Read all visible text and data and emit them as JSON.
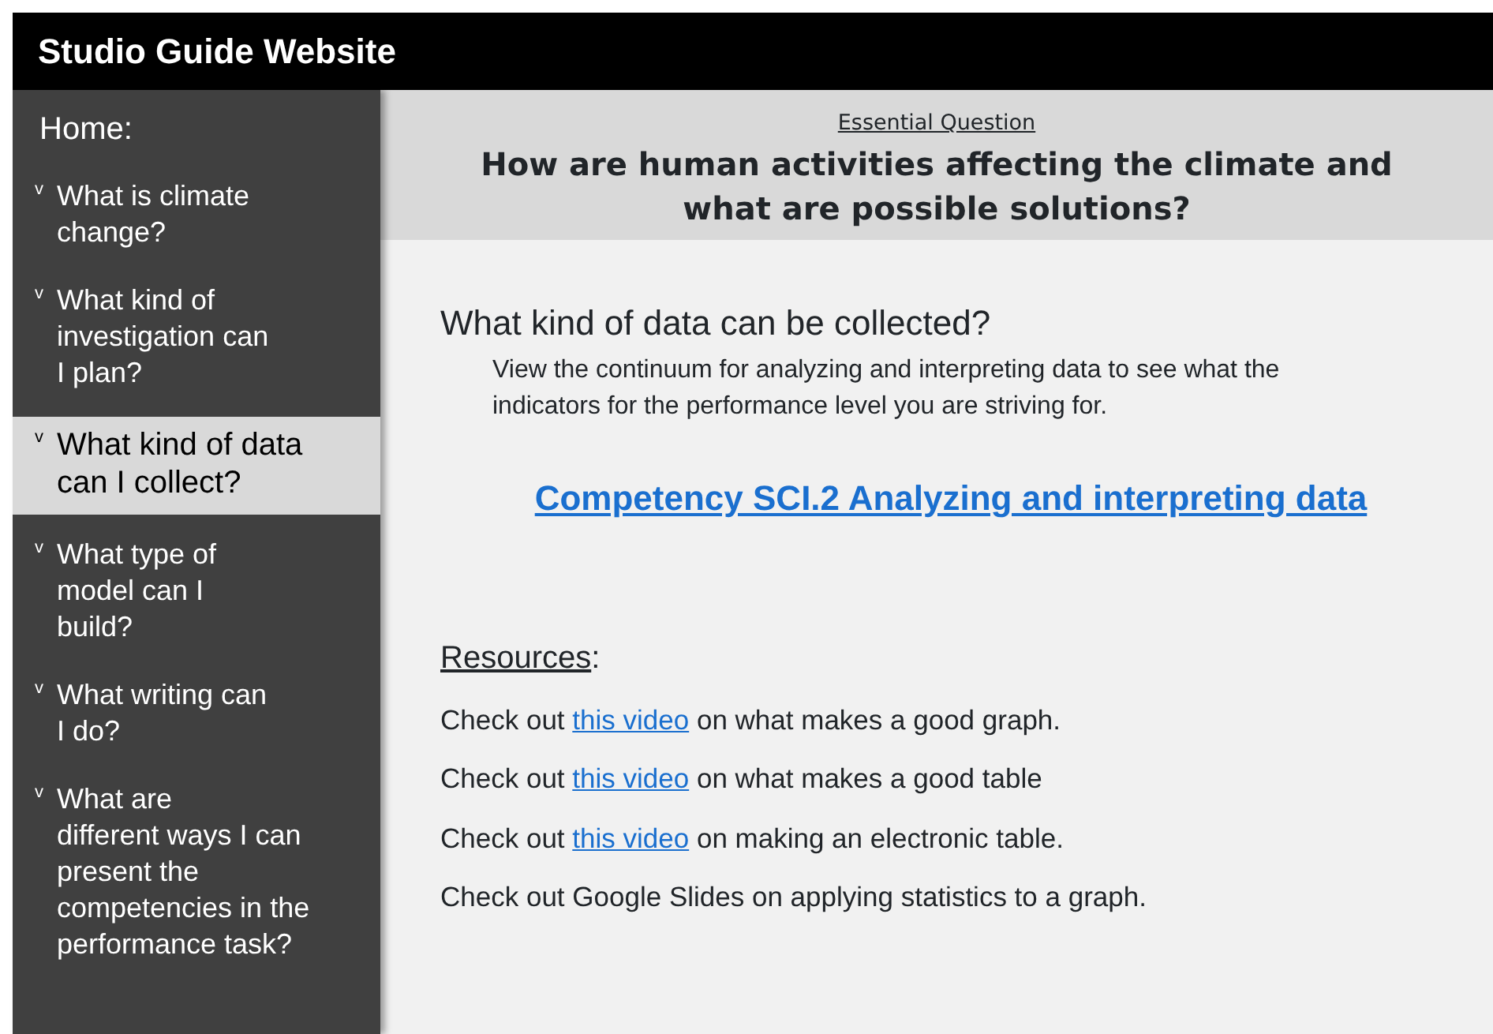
{
  "header": {
    "title": "Studio Guide Website"
  },
  "sidebar": {
    "home": "Home:",
    "items": [
      {
        "marker": "v",
        "lines": [
          "What is climate",
          "change?"
        ],
        "selected": false
      },
      {
        "marker": "v",
        "lines": [
          "What kind of",
          "investigation can",
          "I plan?"
        ],
        "selected": false
      },
      {
        "marker": "v",
        "lines": [
          "What kind of data",
          "can I collect?"
        ],
        "selected": true
      },
      {
        "marker": "v",
        "lines": [
          "What type of",
          "model can I",
          "build?"
        ],
        "selected": false
      },
      {
        "marker": "v",
        "lines": [
          "What writing can",
          "I do?"
        ],
        "selected": false
      },
      {
        "marker": "v",
        "lines": [
          "What are",
          "different ways I can",
          "present the",
          "competencies in the",
          "performance task?"
        ],
        "selected": false
      }
    ]
  },
  "banner": {
    "label": "Essential Question",
    "question": "How are human activities affecting the climate and what are possible solutions?"
  },
  "content": {
    "heading": "What kind of data can be collected?",
    "description": "View the continuum for analyzing and interpreting data to see what the indicators for the performance level you are striving for.",
    "competency_link": "Competency SCI.2 Analyzing and interpreting data",
    "resources_title": "Resources",
    "resources_suffix": ":",
    "resources": [
      {
        "kind": "link",
        "before": "Check out ",
        "link": "this video",
        "after": " on what makes a good graph."
      },
      {
        "kind": "link",
        "before": "Check out ",
        "link": "this video",
        "after": " on what makes a good table"
      },
      {
        "kind": "link",
        "before": "Check out ",
        "link": "this video",
        "after": " on making an electronic table."
      },
      {
        "kind": "plain",
        "text": "Check out Google Slides on applying statistics to a graph."
      }
    ]
  }
}
